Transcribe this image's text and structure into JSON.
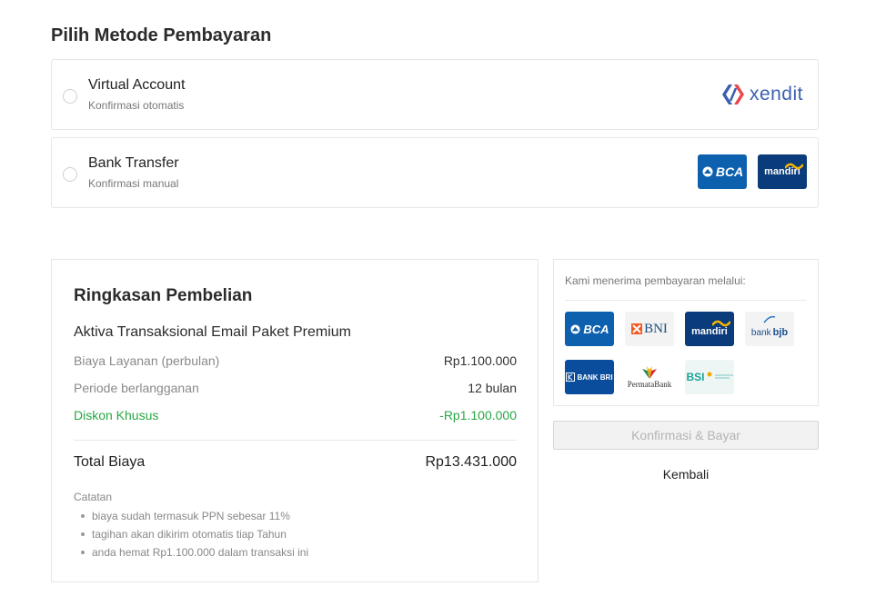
{
  "page": {
    "title": "Pilih Metode Pembayaran"
  },
  "payment_methods": [
    {
      "title": "Virtual Account",
      "subtitle": "Konfirmasi otomatis",
      "provider_logo": "xendit"
    },
    {
      "title": "Bank Transfer",
      "subtitle": "Konfirmasi manual",
      "bank_logos": [
        "BCA",
        "mandiri"
      ]
    }
  ],
  "summary": {
    "title": "Ringkasan Pembelian",
    "product": "Aktiva Transaksional Email Paket Premium",
    "rows": [
      {
        "label": "Biaya Layanan (perbulan)",
        "value": "Rp1.100.000"
      },
      {
        "label": "Periode berlangganan",
        "value": "12 bulan"
      },
      {
        "label": "Diskon Khusus",
        "value": "-Rp1.100.000"
      }
    ],
    "total_label": "Total Biaya",
    "total_value": "Rp13.431.000",
    "notes_title": "Catatan",
    "notes": [
      "biaya sudah termasuk PPN sebesar 11%",
      "tagihan akan dikirim otomatis tiap Tahun",
      "anda hemat Rp1.100.000 dalam transaksi ini"
    ]
  },
  "accepted": {
    "title": "Kami menerima pembayaran melalui:",
    "logos": {
      "bca": "BCA",
      "bni": "BNI",
      "mandiri": "mandiri",
      "bjb_prefix": "bank",
      "bjb_suffix": "bjb",
      "bri": "BANK BRI",
      "permata_a": "Permata",
      "permata_b": "Bank",
      "bsi": "BSI"
    }
  },
  "actions": {
    "confirm": "Konfirmasi & Bayar",
    "back": "Kembali"
  },
  "colors": {
    "bca": "#0d60ad",
    "mandiri": "#0a3b7a",
    "discount": "#28a745",
    "xendit": "#3b5fae",
    "bri": "#0a4d9c",
    "bsi": "#1aa39a"
  }
}
